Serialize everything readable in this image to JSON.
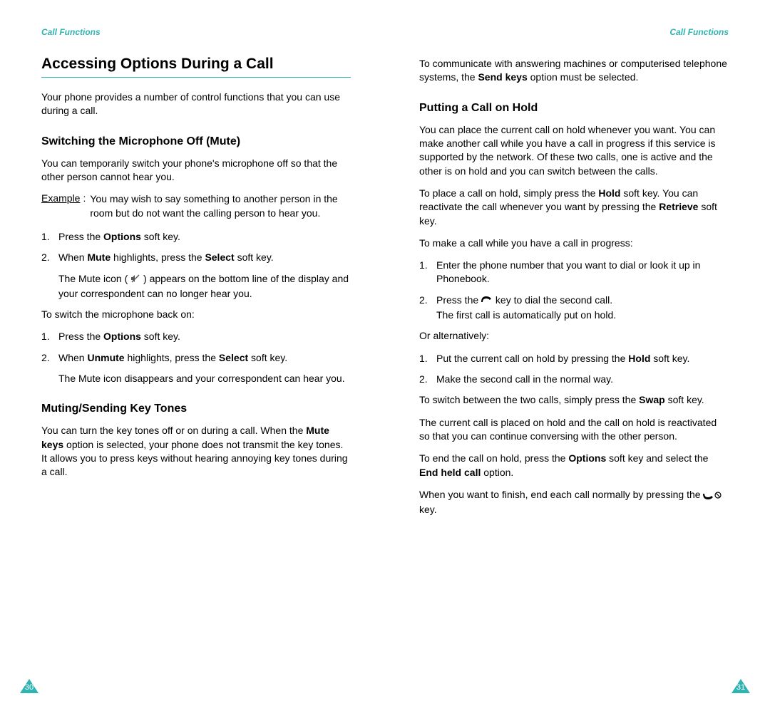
{
  "header": {
    "left": "Call Functions",
    "right": "Call Functions"
  },
  "pageNumbers": {
    "left": "30",
    "right": "31"
  },
  "left": {
    "h1": "Accessing Options During a Call",
    "intro": "Your phone provides a number of control functions that you can use during a call.",
    "sec1": {
      "title": "Switching the Microphone Off (Mute)",
      "p1": "You can temporarily switch your phone's microphone off so that the other person cannot hear you.",
      "exampleLabel": "Example",
      "exampleText": "You may wish to say something to another person in the room but do not want the calling person to hear you.",
      "list1": {
        "i1a": "Press the ",
        "i1b": "Options",
        "i1c": " soft key.",
        "i2a": "When ",
        "i2b": "Mute",
        "i2c": " highlights, press the ",
        "i2d": "Select",
        "i2e": " soft key.",
        "i2subA": "The Mute icon ( ",
        "i2subB": " ) appears on the bottom line of the display and your correspondent can no longer hear you."
      },
      "p2": "To switch the microphone back on:",
      "list2": {
        "i1a": "Press the ",
        "i1b": "Options",
        "i1c": " soft key.",
        "i2a": "When ",
        "i2b": "Unmute",
        "i2c": " highlights, press the ",
        "i2d": "Select",
        "i2e": " soft key.",
        "i2sub": "The Mute icon disappears and your correspondent can hear you."
      }
    },
    "sec2": {
      "title": "Muting/Sending Key Tones",
      "p1a": "You can turn the key tones off or on during a call. When the ",
      "p1b": "Mute keys",
      "p1c": " option is selected, your phone does not transmit the key tones. It allows you to press keys without hearing annoying key tones during a call."
    }
  },
  "right": {
    "p0a": "To communicate with answering machines or computerised telephone systems, the ",
    "p0b": "Send keys",
    "p0c": " option must be selected.",
    "sec1": {
      "title": "Putting a Call on Hold",
      "p1": "You can place the current call on hold whenever you want. You can make another call while you have a call in progress if this service is supported by the network. Of these two calls, one is active and the other is on hold and you can switch between the calls.",
      "p2a": "To place a call on hold, simply press the ",
      "p2b": "Hold",
      "p2c": " soft key. You can reactivate the call whenever you want by pressing the ",
      "p2d": "Retrieve",
      "p2e": " soft key.",
      "p3": "To make a call while you have a call in progress:",
      "list1": {
        "i1": "Enter the phone number that you want to dial or look it up in Phonebook.",
        "i2a": "Press the ",
        "i2b": " key to dial the second call.",
        "i2sub": "The first call is automatically put on hold."
      },
      "p4": "Or alternatively:",
      "list2": {
        "i1a": "Put the current call on hold by pressing the ",
        "i1b": "Hold",
        "i1c": " soft key.",
        "i2": "Make the second call in the normal way."
      },
      "p5a": "To switch between the two calls, simply press the ",
      "p5b": "Swap",
      "p5c": " soft key.",
      "p6": "The current call is placed on hold and the call on hold is reactivated so that you can continue conversing with the other person.",
      "p7a": "To end the call on hold, press the ",
      "p7b": "Options",
      "p7c": " soft key and select the ",
      "p7d": "End held call",
      "p7e": " option.",
      "p8a": "When you want to finish, end each call normally by pressing the ",
      "p8b": " key."
    }
  }
}
